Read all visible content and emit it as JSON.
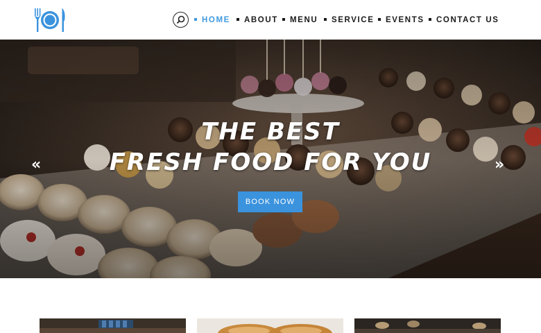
{
  "header": {
    "logo_icon": "plate-fork-knife-icon",
    "search_icon": "search-icon",
    "nav": [
      {
        "label": "HOME",
        "active": true
      },
      {
        "label": "ABOUT",
        "active": false
      },
      {
        "label": "MENU",
        "active": false
      },
      {
        "label": "SERVICE",
        "active": false
      },
      {
        "label": "EVENTS",
        "active": false
      },
      {
        "label": "CONTACT US",
        "active": false
      }
    ]
  },
  "hero": {
    "title_line1": "THE BEST",
    "title_line2": "FRESH FOOD FOR YOU",
    "cta_label": "BOOK NOW",
    "prev_icon": "double-chevron-left-icon",
    "next_icon": "double-chevron-right-icon"
  },
  "colors": {
    "accent": "#3b93de",
    "nav_active": "#3f9ae0",
    "nav_text": "#1a1a1a"
  }
}
